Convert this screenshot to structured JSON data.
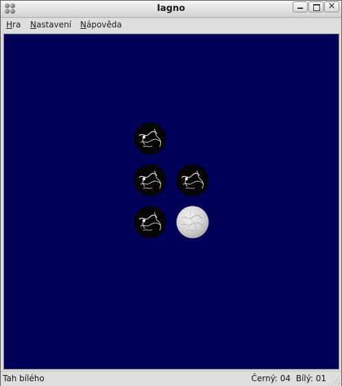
{
  "window": {
    "title": "Iagno"
  },
  "menu": {
    "items": [
      {
        "label_accel": "H",
        "label_rest": "ra"
      },
      {
        "label_accel": "N",
        "label_rest": "astavení"
      },
      {
        "label_accel": "N",
        "label_rest": "ápověda"
      }
    ]
  },
  "board": {
    "background_color": "#000059",
    "pieces": [
      {
        "color": "black"
      },
      {
        "color": "black"
      },
      {
        "color": "black"
      },
      {
        "color": "black"
      },
      {
        "color": "white"
      }
    ]
  },
  "status": {
    "message": "Tah bílého",
    "black_label": "Černý:",
    "black_count": "04",
    "white_label": "Bílý:",
    "white_count": "01"
  },
  "icons": {
    "app": "iagno-logo-icon",
    "minimize": "minimize-icon",
    "maximize": "maximize-icon",
    "close": "close-icon",
    "resize": "resize-grip-icon"
  }
}
